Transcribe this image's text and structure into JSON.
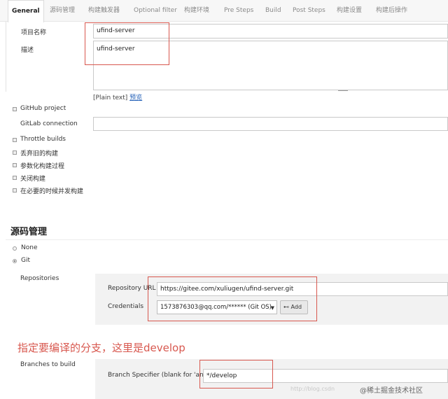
{
  "tabs": [
    {
      "label": "General",
      "active": true
    },
    {
      "label": "源码管理"
    },
    {
      "label": "构建触发器"
    },
    {
      "label": "Optional filter"
    },
    {
      "label": "构建环境"
    },
    {
      "label": "Pre Steps"
    },
    {
      "label": "Build"
    },
    {
      "label": "Post Steps"
    },
    {
      "label": "构建设置"
    },
    {
      "label": "构建后操作"
    }
  ],
  "general": {
    "project_name_label": "项目名称",
    "project_name_value": "ufind-server",
    "description_label": "描述",
    "description_value": "ufind-server",
    "plain_text": "[Plain text]",
    "preview_link": "预览",
    "github_project": "GitHub project",
    "gitlab_connection": "GitLab connection",
    "throttle_builds": "Throttle builds",
    "discard_old": "丢弃旧的构建",
    "parameterized": "参数化构建过程",
    "disable_build": "关闭构建",
    "concurrent": "在必要的时候并发构建"
  },
  "scm": {
    "title": "源码管理",
    "none_label": "None",
    "git_label": "Git",
    "selected": "Git",
    "repositories_label": "Repositories",
    "repository_url_label": "Repository URL",
    "repository_url_value": "https://gitee.com/xuliugen/ufind-server.git",
    "credentials_label": "Credentials",
    "credentials_value": "1573876303@qq.com/****** (Git OS)",
    "add_button": "Add",
    "annotation": "指定要编译的分支，这里是develop",
    "branches_label": "Branches to build",
    "branch_specifier_label": "Branch Specifier (blank for 'any')",
    "branch_specifier_value": "*/develop"
  },
  "watermark": "@稀土掘金技术社区",
  "faint_watermark": "http://blog.csdn"
}
